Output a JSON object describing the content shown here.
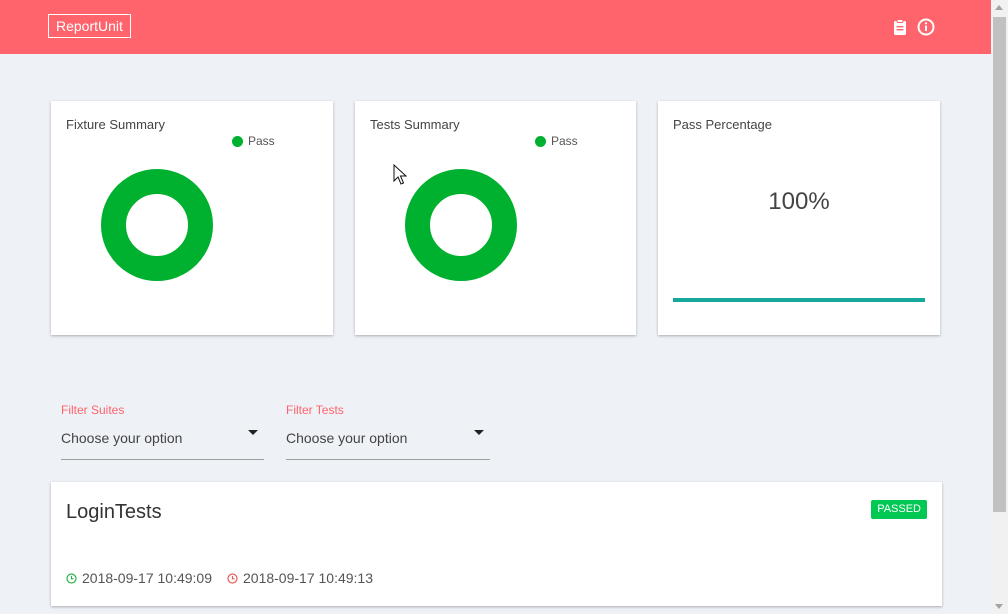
{
  "header": {
    "brand": "ReportUnit",
    "icons": [
      "clipboard-icon",
      "info-icon"
    ],
    "color": "#ff636c"
  },
  "cards": {
    "fixture": {
      "title": "Fixture Summary",
      "legend": "Pass",
      "pass_count_share": 1.0,
      "color": "#00b02f"
    },
    "tests": {
      "title": "Tests Summary",
      "legend": "Pass",
      "pass_count_share": 1.0,
      "color": "#00b02f"
    },
    "pass_percentage": {
      "title": "Pass Percentage",
      "value_text": "100%",
      "progress": 1.0,
      "color": "#16a89b"
    }
  },
  "filters": {
    "suites": {
      "label": "Filter Suites",
      "value": "Choose your option"
    },
    "tests": {
      "label": "Filter Tests",
      "value": "Choose your option"
    }
  },
  "suite": {
    "name": "LoginTests",
    "status": "PASSED",
    "start_time": "2018-09-17 10:49:09",
    "end_time": "2018-09-17 10:49:13"
  }
}
